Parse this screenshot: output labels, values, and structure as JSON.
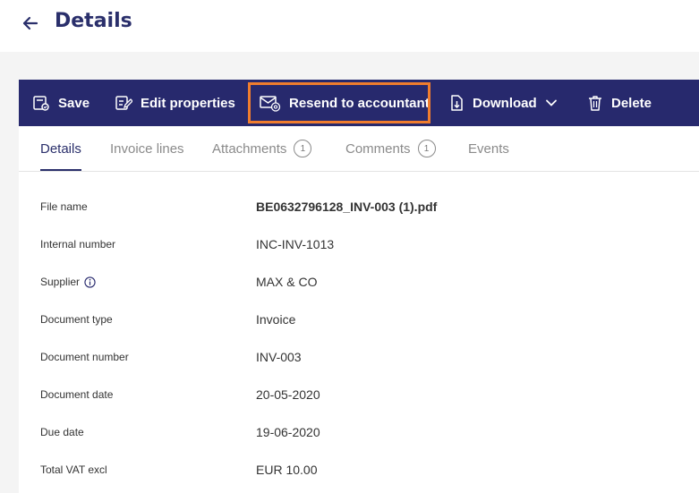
{
  "header": {
    "title": "Details",
    "back_icon": "arrow-left-icon"
  },
  "toolbar": {
    "save": {
      "label": "Save",
      "icon": "save-icon"
    },
    "edit": {
      "label": "Edit properties",
      "icon": "edit-icon"
    },
    "resend": {
      "label": "Resend to accountant",
      "icon": "mail-at-icon",
      "highlight_color": "#f07d2e"
    },
    "download": {
      "label": "Download",
      "icon": "download-icon"
    },
    "delete": {
      "label": "Delete",
      "icon": "trash-icon"
    },
    "background": "#27296d"
  },
  "tabs": [
    {
      "label": "Details",
      "active": true
    },
    {
      "label": "Invoice lines"
    },
    {
      "label": "Attachments",
      "badge": "1"
    },
    {
      "label": "Comments",
      "badge": "1"
    },
    {
      "label": "Events"
    }
  ],
  "fields": [
    {
      "label": "File name",
      "value": "BE0632796128_INV-003 (1).pdf"
    },
    {
      "label": "Internal number",
      "value": "INC-INV-1013"
    },
    {
      "label": "Supplier",
      "value": "MAX & CO"
    },
    {
      "label": "Document type",
      "value": "Invoice"
    },
    {
      "label": "Document number",
      "value": "INV-003"
    },
    {
      "label": "Document date",
      "value": "20-05-2020"
    },
    {
      "label": "Due date",
      "value": "19-06-2020"
    },
    {
      "label": "Total VAT excl",
      "value": "EUR 10.00"
    }
  ]
}
